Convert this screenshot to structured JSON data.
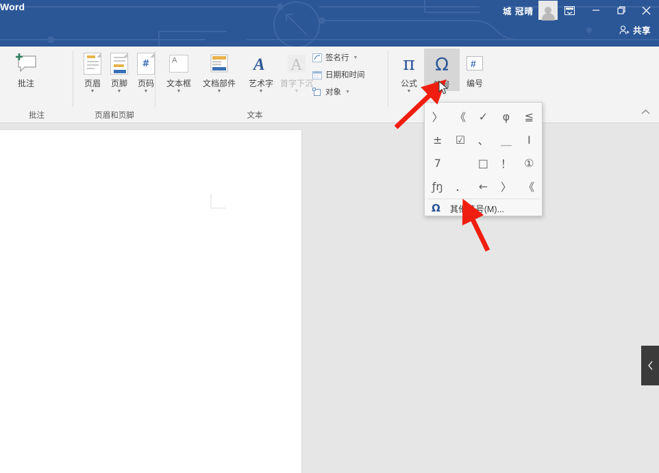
{
  "window": {
    "app_title": "Word",
    "user_name": "城 冠晴",
    "avatar_icon": "user-avatar-icon",
    "ribbon_display_icon": "ribbon-display-options-icon",
    "minimize_icon": "minimize-icon",
    "restore_icon": "restore-icon",
    "close_icon": "close-icon",
    "share_label": "共享",
    "share_icon": "person-add-icon",
    "titlebar_color": "#2b5797"
  },
  "ribbon": {
    "collapse_icon": "chevron-up-icon",
    "groups": [
      {
        "name": "comments",
        "label": "批注",
        "buttons": [
          {
            "name": "new-comment",
            "label": "批注",
            "icon": "comment-plus-icon",
            "has_caret": false,
            "disabled": false
          }
        ]
      },
      {
        "name": "header-footer",
        "label": "页眉和页脚",
        "buttons": [
          {
            "name": "header",
            "label": "页眉",
            "icon": "page-header-icon",
            "has_caret": true,
            "disabled": false
          },
          {
            "name": "footer",
            "label": "页脚",
            "icon": "page-footer-icon",
            "has_caret": true,
            "disabled": false
          },
          {
            "name": "page-number",
            "label": "页码",
            "icon": "page-number-icon",
            "has_caret": true,
            "disabled": false
          }
        ]
      },
      {
        "name": "text",
        "label": "文本",
        "buttons": [
          {
            "name": "text-box",
            "label": "文本框",
            "icon": "text-box-icon",
            "has_caret": true,
            "disabled": false
          },
          {
            "name": "document-parts",
            "label": "文档部件",
            "icon": "quick-parts-icon",
            "has_caret": true,
            "disabled": false
          },
          {
            "name": "word-art",
            "label": "艺术字",
            "icon": "word-art-icon",
            "has_caret": true,
            "disabled": false
          },
          {
            "name": "drop-cap",
            "label": "首字下沉",
            "icon": "drop-cap-icon",
            "has_caret": true,
            "disabled": true
          }
        ],
        "small_items": [
          {
            "name": "signature-line",
            "label": "签名行",
            "icon": "signature-line-icon",
            "has_caret": true
          },
          {
            "name": "date-and-time",
            "label": "日期和时间",
            "icon": "date-time-icon",
            "has_caret": false
          },
          {
            "name": "object",
            "label": "对象",
            "icon": "object-icon",
            "has_caret": true
          }
        ]
      },
      {
        "name": "symbols",
        "label": "",
        "buttons": [
          {
            "name": "equation",
            "label": "公式",
            "icon": "pi-icon",
            "has_caret": true,
            "disabled": false
          },
          {
            "name": "symbol",
            "label": "符号",
            "icon": "omega-icon",
            "has_caret": false,
            "disabled": false,
            "active": true
          },
          {
            "name": "numbering",
            "label": "编号",
            "icon": "number-sign-icon",
            "has_caret": false,
            "disabled": false
          }
        ]
      }
    ]
  },
  "symbol_dropdown": {
    "name": "symbol-gallery",
    "symbols": [
      "〉",
      "《",
      "✓",
      "φ",
      "≦",
      "±",
      "☑",
      "、",
      "＿",
      "Ⅰ",
      "7",
      "",
      "□",
      "！",
      "①",
      "ƒŋ",
      "．",
      "←",
      "〉",
      "《"
    ],
    "more_label": "其他符号(M)...",
    "more_icon": "omega-icon"
  },
  "document": {
    "page_name": "document-page",
    "margin_mark": "text-margin-corner-mark"
  },
  "side_panel": {
    "toggle_icon": "chevron-left-icon",
    "toggle_name": "side-panel-collapse-toggle"
  },
  "annotations": {
    "arrow_color": "#f01e10",
    "arrow1_target": "符号",
    "arrow2_target": "其他符号(M)..."
  }
}
